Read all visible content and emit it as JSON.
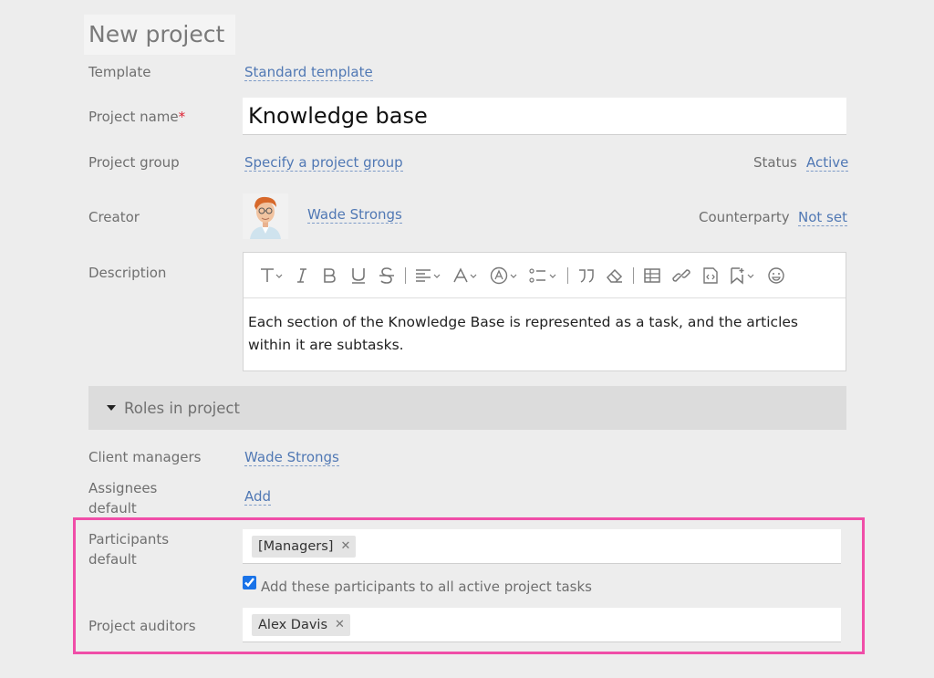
{
  "page": {
    "title": "New project"
  },
  "form": {
    "template": {
      "label": "Template",
      "value": "Standard template"
    },
    "project_name": {
      "label": "Project name",
      "required_mark": "*",
      "value": "Knowledge base"
    },
    "project_group": {
      "label": "Project group",
      "value": "Specify a project group"
    },
    "status": {
      "label": "Status",
      "value": "Active"
    },
    "creator": {
      "label": "Creator",
      "value": "Wade Strongs"
    },
    "counterparty": {
      "label": "Counterparty",
      "value": "Not set"
    },
    "description": {
      "label": "Description",
      "text": "Each section of the Knowledge Base is represented as a task, and the articles within it are subtasks."
    }
  },
  "roles": {
    "section_title": "Roles in project",
    "client_managers": {
      "label": "Client managers",
      "value": "Wade Strongs"
    },
    "assignees_default": {
      "label": "Assignees default",
      "value": "Add"
    },
    "participants_default": {
      "label": "Participants default",
      "tags": [
        "[Managers]"
      ]
    },
    "add_participants": {
      "label": "Add these participants to all active project tasks",
      "checked": true
    },
    "project_auditors": {
      "label": "Project auditors",
      "tags": [
        "Alex Davis"
      ]
    }
  },
  "icons": {
    "toolbar": [
      "text-style-icon",
      "italic-icon",
      "bold-icon",
      "underline-icon",
      "strikethrough-icon",
      "align-icon",
      "font-color-icon",
      "highlight-color-icon",
      "list-icon",
      "quote-icon",
      "eraser-icon",
      "table-icon",
      "link-icon",
      "code-icon",
      "bookmark-icon",
      "emoji-icon"
    ],
    "tag_remove": "close-icon",
    "section_toggle": "caret-down-icon"
  },
  "colors": {
    "link": "#5078b4",
    "highlight_border": "#f04ea8",
    "required": "#dd2233"
  }
}
